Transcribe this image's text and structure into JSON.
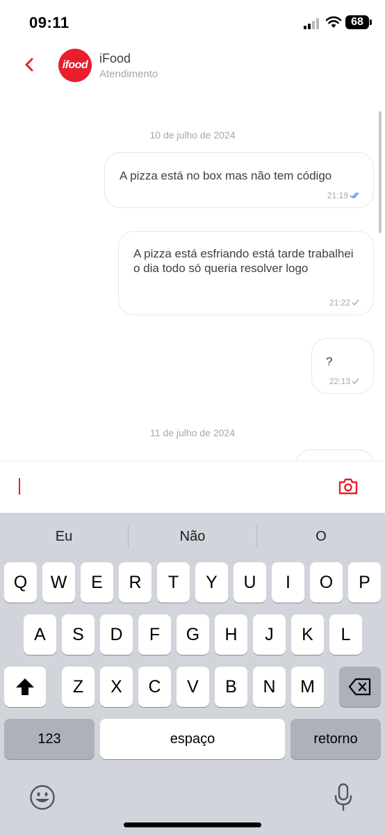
{
  "status": {
    "time": "09:11",
    "battery": "68"
  },
  "header": {
    "name": "iFood",
    "subtitle": "Atendimento",
    "logo_text": "ifood"
  },
  "chat": {
    "dates": [
      "10 de julho de 2024",
      "11 de julho de 2024"
    ],
    "messages": [
      {
        "text": "A pizza está no box mas não tem código",
        "time": "21:19",
        "status": "read"
      },
      {
        "text": "A pizza está esfriando está tarde trabalhei o dia todo só queria resolver logo",
        "time": "21:22",
        "status": "sent"
      },
      {
        "text": "?",
        "time": "22:13",
        "status": "sent"
      }
    ]
  },
  "keyboard": {
    "suggestions": [
      "Eu",
      "Não",
      "O"
    ],
    "row1": [
      "Q",
      "W",
      "E",
      "R",
      "T",
      "Y",
      "U",
      "I",
      "O",
      "P"
    ],
    "row2": [
      "A",
      "S",
      "D",
      "F",
      "G",
      "H",
      "J",
      "K",
      "L"
    ],
    "row3": [
      "Z",
      "X",
      "C",
      "V",
      "B",
      "N",
      "M"
    ],
    "numbers_label": "123",
    "space_label": "espaço",
    "return_label": "retorno"
  },
  "colors": {
    "brand": "#ea1d2c",
    "read_tick": "#3b82f6"
  }
}
